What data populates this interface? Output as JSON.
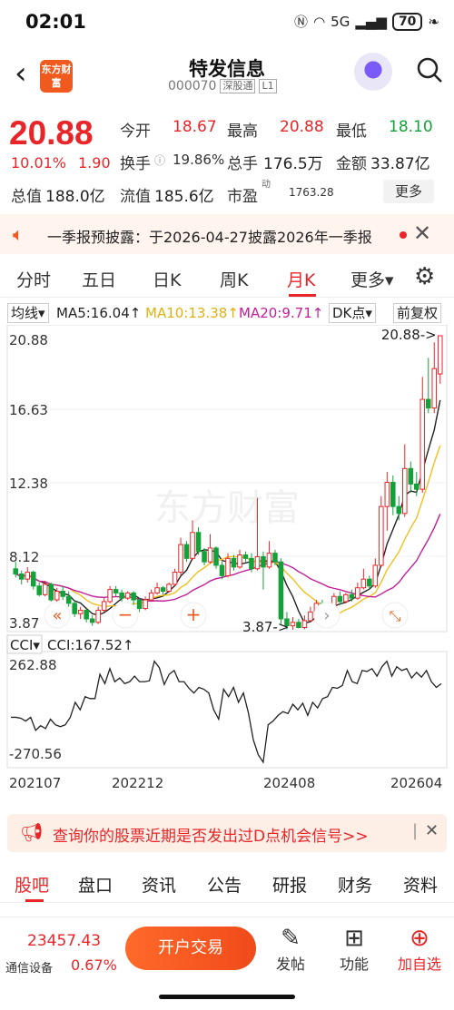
{
  "status": {
    "time": "02:01",
    "network": "5G",
    "battery": "70"
  },
  "header": {
    "logo_text": "东方财富",
    "title": "特发信息",
    "code": "000070",
    "tag1": "深股通",
    "tag2": "L1"
  },
  "quote": {
    "price": "20.88",
    "pct": "10.01%",
    "chg": "1.90",
    "open_label": "今开",
    "open": "18.67",
    "high_label": "最高",
    "high": "20.88",
    "low_label": "最低",
    "low": "18.10",
    "turnover_label": "换手",
    "turnover": "19.86%",
    "vol_label": "总手",
    "vol": "176.5万",
    "amount_label": "金额",
    "amount": "33.87亿",
    "mcap_label": "总值",
    "mcap": "188.0亿",
    "float_label": "流值",
    "float": "185.6亿",
    "pe_label": "市盈",
    "pe_sup": "动",
    "pe": "1763.28",
    "more": "更多"
  },
  "notice": {
    "text": "一季报预披露：于2026-04-27披露2026年一季报"
  },
  "tabs": [
    "分时",
    "五日",
    "日K",
    "周K",
    "月K",
    "更多▾"
  ],
  "ma_bar": {
    "type": "均线",
    "ma5": "MA5:16.04↑",
    "ma10": "MA10:13.38↑",
    "ma20": "MA20:9.71↑",
    "dk": "DK点",
    "adjust": "前复权"
  },
  "colors": {
    "up": "#e8262a",
    "down": "#13a13a",
    "ma5": "#222222",
    "ma10": "#f0c020",
    "ma20": "#c0209a",
    "accent": "#e8262a"
  },
  "chart_data": {
    "type": "candlestick",
    "price_axis_labels": [
      "20.88",
      "16.63",
      "12.38",
      "8.12",
      "3.87"
    ],
    "ylim": [
      3.87,
      20.88
    ],
    "max_marker": "20.88->",
    "min_marker": "3.87->",
    "watermark": "东方财富",
    "x_labels": [
      "202107",
      "202212",
      "202408",
      "202604"
    ],
    "candles": [
      [
        7.4,
        7.1,
        7.8,
        6.9
      ],
      [
        7.1,
        6.8,
        7.3,
        6.5
      ],
      [
        6.8,
        7.2,
        7.5,
        6.6
      ],
      [
        7.2,
        6.4,
        7.3,
        6.2
      ],
      [
        6.4,
        5.9,
        6.6,
        5.8
      ],
      [
        5.9,
        6.5,
        6.7,
        5.8
      ],
      [
        6.5,
        5.6,
        6.6,
        5.5
      ],
      [
        5.6,
        6.1,
        6.3,
        5.5
      ],
      [
        6.1,
        5.8,
        6.4,
        5.6
      ],
      [
        5.8,
        5.4,
        6.1,
        5.2
      ],
      [
        5.4,
        4.8,
        5.6,
        4.6
      ],
      [
        4.8,
        5.0,
        5.2,
        4.5
      ],
      [
        5.0,
        4.5,
        5.1,
        4.3
      ],
      [
        4.5,
        4.3,
        4.7,
        4.1
      ],
      [
        4.3,
        5.0,
        5.2,
        4.2
      ],
      [
        5.0,
        5.5,
        5.7,
        4.9
      ],
      [
        5.5,
        6.2,
        6.4,
        5.4
      ],
      [
        6.2,
        6.0,
        6.4,
        5.8
      ],
      [
        6.0,
        5.7,
        6.2,
        5.5
      ],
      [
        5.7,
        6.0,
        6.1,
        5.6
      ],
      [
        6.0,
        5.6,
        6.1,
        5.3
      ],
      [
        5.6,
        5.1,
        5.7,
        4.9
      ],
      [
        5.1,
        5.6,
        5.8,
        5.0
      ],
      [
        5.6,
        6.0,
        6.2,
        5.5
      ],
      [
        6.0,
        6.3,
        6.6,
        5.9
      ],
      [
        6.3,
        6.1,
        6.4,
        5.9
      ],
      [
        6.1,
        6.5,
        6.6,
        6.0
      ],
      [
        6.5,
        7.2,
        7.4,
        6.4
      ],
      [
        7.2,
        8.8,
        9.2,
        7.0
      ],
      [
        8.8,
        8.0,
        9.0,
        7.8
      ],
      [
        8.0,
        9.5,
        10.2,
        7.9
      ],
      [
        9.5,
        8.4,
        9.8,
        8.2
      ],
      [
        8.4,
        7.8,
        8.6,
        7.6
      ],
      [
        7.8,
        8.6,
        9.4,
        7.7
      ],
      [
        8.6,
        7.6,
        8.7,
        7.4
      ],
      [
        7.6,
        7.0,
        7.8,
        6.8
      ],
      [
        7.0,
        8.0,
        8.3,
        6.9
      ],
      [
        8.0,
        7.5,
        8.2,
        7.3
      ],
      [
        7.5,
        8.2,
        8.5,
        7.4
      ],
      [
        8.2,
        8.0,
        8.4,
        7.8
      ],
      [
        8.0,
        7.4,
        8.3,
        7.2
      ],
      [
        7.4,
        8.1,
        11.5,
        7.3
      ],
      [
        8.1,
        7.5,
        8.4,
        6.2
      ],
      [
        7.5,
        8.3,
        9.0,
        7.4
      ],
      [
        8.3,
        7.8,
        8.5,
        7.6
      ],
      [
        7.8,
        4.5,
        8.0,
        4.2
      ],
      [
        4.5,
        4.1,
        4.9,
        3.9
      ],
      [
        4.1,
        4.3,
        4.6,
        3.87
      ],
      [
        4.3,
        4.0,
        4.5,
        3.95
      ],
      [
        4.0,
        4.4,
        4.7,
        3.9
      ],
      [
        4.4,
        4.9,
        5.2,
        4.3
      ],
      [
        4.9,
        5.4,
        5.6,
        4.8
      ],
      [
        5.4,
        4.9,
        5.6,
        4.7
      ],
      [
        4.9,
        5.2,
        5.4,
        4.6
      ],
      [
        5.2,
        5.8,
        6.0,
        5.1
      ],
      [
        5.8,
        5.5,
        6.1,
        5.3
      ],
      [
        5.5,
        5.9,
        6.0,
        5.4
      ],
      [
        5.9,
        5.7,
        6.2,
        5.5
      ],
      [
        5.7,
        6.3,
        6.6,
        5.6
      ],
      [
        6.3,
        6.8,
        7.4,
        6.2
      ],
      [
        6.8,
        6.4,
        7.0,
        6.2
      ],
      [
        6.4,
        7.6,
        8.0,
        6.3
      ],
      [
        7.6,
        11.0,
        11.6,
        7.5
      ],
      [
        11.0,
        12.4,
        13.0,
        9.6
      ],
      [
        12.4,
        11.0,
        12.8,
        10.5
      ],
      [
        11.0,
        10.6,
        11.6,
        10.2
      ],
      [
        10.6,
        13.2,
        14.6,
        10.4
      ],
      [
        13.2,
        12.3,
        13.6,
        11.8
      ],
      [
        12.3,
        12.0,
        13.0,
        11.6
      ],
      [
        12.0,
        17.2,
        18.5,
        11.8
      ],
      [
        17.2,
        16.7,
        19.6,
        16.4
      ],
      [
        16.7,
        18.98,
        20.5,
        16.4
      ],
      [
        18.67,
        20.88,
        20.88,
        18.1
      ]
    ],
    "cci_axis_labels": [
      "262.88",
      "-270.56"
    ],
    "cci_label": "CCI",
    "cci_value": "CCI:167.52↑",
    "cci": [
      -40,
      -40,
      -45,
      -60,
      -40,
      -110,
      -85,
      -100,
      -50,
      -80,
      -90,
      -80,
      -40,
      40,
      0,
      70,
      60,
      60,
      190,
      140,
      220,
      150,
      170,
      140,
      150,
      180,
      150,
      150,
      155,
      260,
      225,
      135,
      190,
      210,
      150,
      150,
      115,
      90,
      120,
      110,
      90,
      0,
      -50,
      110,
      70,
      120,
      40,
      90,
      -15,
      -160,
      -240,
      -280,
      -80,
      -60,
      -30,
      -10,
      -20,
      30,
      0,
      35,
      -30,
      40,
      10,
      60,
      70,
      120,
      115,
      130,
      210,
      150,
      140,
      210,
      205,
      220,
      180,
      230,
      260,
      180,
      230,
      210,
      220,
      170,
      200,
      175,
      210,
      150,
      120,
      140
    ]
  },
  "promo": {
    "text": "查询你的股票近期是否发出过D点机会信号>>"
  },
  "bottom_tabs": [
    "股吧",
    "盘口",
    "资讯",
    "公告",
    "研报",
    "财务",
    "资料"
  ],
  "footer": {
    "index_value": "23457.43",
    "index_name": "通信设备",
    "index_pct": "0.67%",
    "trade": "开户交易",
    "post": "发帖",
    "func": "功能",
    "add": "加自选"
  }
}
